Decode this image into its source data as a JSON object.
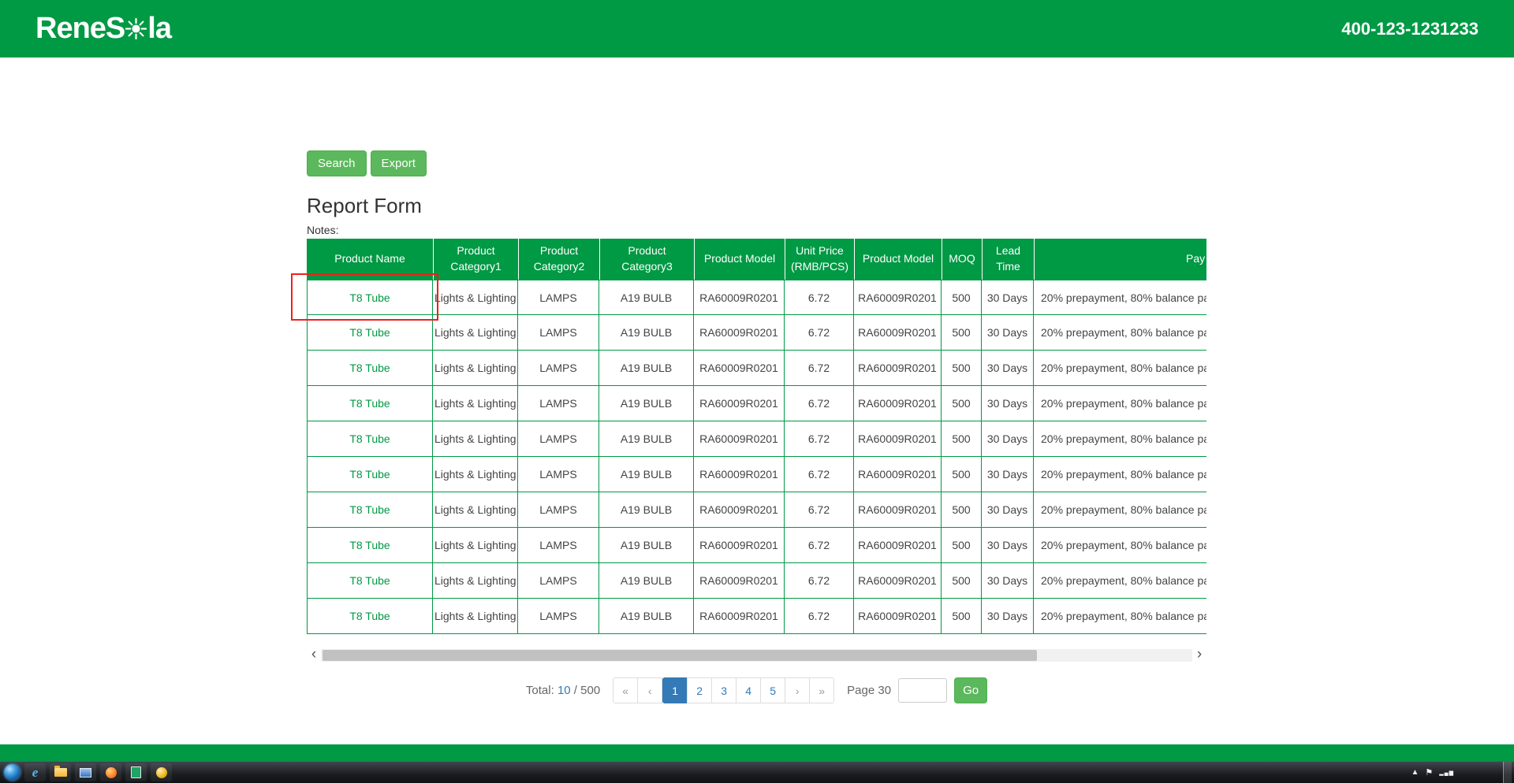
{
  "header": {
    "logo_prefix": "ReneS",
    "logo_suffix": "la",
    "phone": "400-123-1231233"
  },
  "toolbar": {
    "search_label": "Search",
    "export_label": "Export"
  },
  "report": {
    "title": "Report Form",
    "notes_label": "Notes:"
  },
  "table": {
    "headers": [
      "Product Name",
      "Product Category1",
      "Product Category2",
      "Product Category3",
      "Product Model",
      "Unit Price (RMB/PCS)",
      "Product Model",
      "MOQ",
      "Lead Time",
      "Pay"
    ],
    "rows": [
      [
        "T8 Tube",
        "Lights & Lighting",
        "LAMPS",
        "A19 BULB",
        "RA60009R0201",
        "6.72",
        "RA60009R0201",
        "500",
        "30 Days",
        "20% prepayment, 80% balance pa"
      ],
      [
        "T8 Tube",
        "Lights & Lighting",
        "LAMPS",
        "A19 BULB",
        "RA60009R0201",
        "6.72",
        "RA60009R0201",
        "500",
        "30 Days",
        "20% prepayment, 80% balance pa"
      ],
      [
        "T8 Tube",
        "Lights & Lighting",
        "LAMPS",
        "A19 BULB",
        "RA60009R0201",
        "6.72",
        "RA60009R0201",
        "500",
        "30 Days",
        "20% prepayment, 80% balance pa"
      ],
      [
        "T8 Tube",
        "Lights & Lighting",
        "LAMPS",
        "A19 BULB",
        "RA60009R0201",
        "6.72",
        "RA60009R0201",
        "500",
        "30 Days",
        "20% prepayment, 80% balance pa"
      ],
      [
        "T8 Tube",
        "Lights & Lighting",
        "LAMPS",
        "A19 BULB",
        "RA60009R0201",
        "6.72",
        "RA60009R0201",
        "500",
        "30 Days",
        "20% prepayment, 80% balance pa"
      ],
      [
        "T8 Tube",
        "Lights & Lighting",
        "LAMPS",
        "A19 BULB",
        "RA60009R0201",
        "6.72",
        "RA60009R0201",
        "500",
        "30 Days",
        "20% prepayment, 80% balance pa"
      ],
      [
        "T8 Tube",
        "Lights & Lighting",
        "LAMPS",
        "A19 BULB",
        "RA60009R0201",
        "6.72",
        "RA60009R0201",
        "500",
        "30 Days",
        "20% prepayment, 80% balance pa"
      ],
      [
        "T8 Tube",
        "Lights & Lighting",
        "LAMPS",
        "A19 BULB",
        "RA60009R0201",
        "6.72",
        "RA60009R0201",
        "500",
        "30 Days",
        "20% prepayment, 80% balance pa"
      ],
      [
        "T8 Tube",
        "Lights & Lighting",
        "LAMPS",
        "A19 BULB",
        "RA60009R0201",
        "6.72",
        "RA60009R0201",
        "500",
        "30 Days",
        "20% prepayment, 80% balance pa"
      ],
      [
        "T8 Tube",
        "Lights & Lighting",
        "LAMPS",
        "A19 BULB",
        "RA60009R0201",
        "6.72",
        "RA60009R0201",
        "500",
        "30 Days",
        "20% prepayment, 80% balance pa"
      ]
    ]
  },
  "scrollbar": {
    "left_arrow": "‹",
    "right_arrow": "›"
  },
  "pagination": {
    "total_label": "Total:",
    "total_current": "10",
    "total_separator": "/",
    "total_overall": "500",
    "first_label": "«",
    "prev_label": "‹",
    "pages": [
      "1",
      "2",
      "3",
      "4",
      "5"
    ],
    "active_page": "1",
    "next_label": "›",
    "last_label": "»",
    "page_label": "Page 30",
    "goto_value": "",
    "go_label": "Go"
  },
  "colors": {
    "brand_green": "#009944",
    "button_green": "#5cb85c",
    "active_blue": "#337ab7",
    "annotation_red": "#f0201e"
  }
}
